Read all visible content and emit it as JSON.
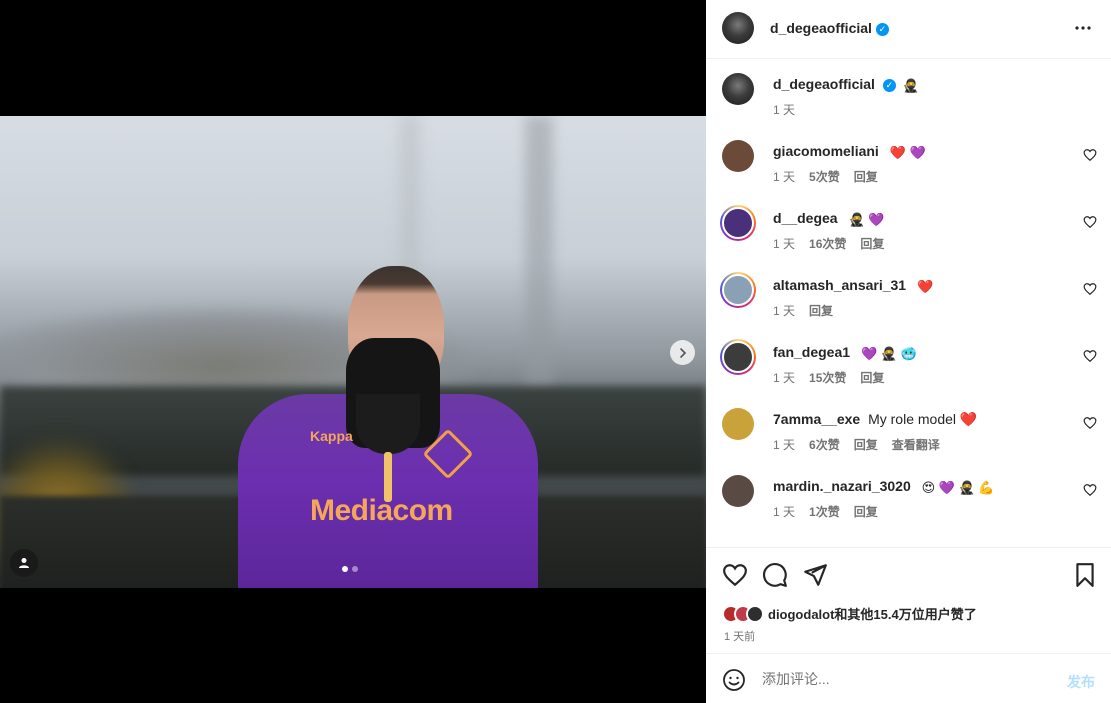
{
  "post": {
    "author": "d_degeaofficial",
    "verified": true,
    "photo_sponsor": "Mediacom",
    "photo_brand": "Kappa",
    "carousel": {
      "slide_count": 2,
      "current": 1
    },
    "caption": {
      "username": "d_degeaofficial",
      "text": "🥷",
      "time": "1 天"
    }
  },
  "comments": [
    {
      "username": "giacomomeliani",
      "text": "❤️ 💜",
      "time": "1 天",
      "likes": "5次赞",
      "reply": "回复",
      "translate": "",
      "story_ring": false,
      "avatar_color": "#6b4a3a"
    },
    {
      "username": "d__degea",
      "text": "🥷 💜",
      "time": "1 天",
      "likes": "16次赞",
      "reply": "回复",
      "translate": "",
      "story_ring": true,
      "avatar_color": "#4a2f7a"
    },
    {
      "username": "altamash_ansari_31",
      "text": "❤️",
      "time": "1 天",
      "likes": "",
      "reply": "回复",
      "translate": "",
      "story_ring": true,
      "avatar_color": "#8aa0b5"
    },
    {
      "username": "fan_degea1",
      "text": "💜 🥷 🥶",
      "time": "1 天",
      "likes": "15次赞",
      "reply": "回复",
      "translate": "",
      "story_ring": true,
      "avatar_color": "#3c3c3c"
    },
    {
      "username": "7amma__exe",
      "text": "My role model ❤️",
      "time": "1 天",
      "likes": "6次赞",
      "reply": "回复",
      "translate": "查看翻译",
      "story_ring": false,
      "avatar_color": "#c9a23a"
    },
    {
      "username": "mardin._nazari_3020",
      "text": "😍 💜 🥷 💪",
      "time": "1 天",
      "likes": "1次赞",
      "reply": "回复",
      "translate": "",
      "story_ring": false,
      "avatar_color": "#5a4a44"
    }
  ],
  "likes_summary": "diogodalot和其他15.4万位用户赞了",
  "posted_ago": "1 天前",
  "compose": {
    "placeholder": "添加评论...",
    "post_label": "发布"
  },
  "icons": [
    "more-icon",
    "heart-icon",
    "comment-icon",
    "share-icon",
    "bookmark-icon",
    "emoji-icon",
    "chevron-right-icon",
    "user-tag-icon"
  ],
  "colors": {
    "verified": "#0095f6",
    "post_disabled": "#b2dffc",
    "meta_text": "#737373"
  }
}
